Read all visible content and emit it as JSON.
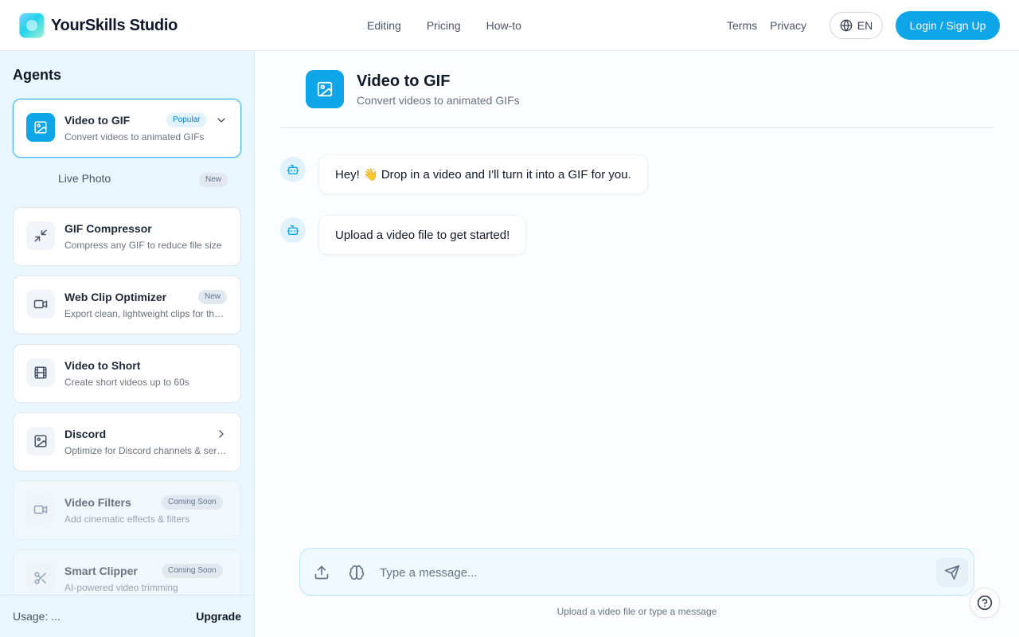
{
  "header": {
    "brand": "YourSkills Studio",
    "nav": [
      "Editing",
      "Pricing",
      "How-to"
    ],
    "terms": "Terms",
    "privacy": "Privacy",
    "language": "EN",
    "login": "Login / Sign Up"
  },
  "sidebar": {
    "title": "Agents",
    "agents": [
      {
        "title": "Video to GIF",
        "desc": "Convert videos to animated GIFs",
        "badge": "Popular",
        "icon": "image-icon",
        "state": "active"
      },
      {
        "title": "GIF Compressor",
        "desc": "Compress any GIF to reduce file size",
        "badge": "",
        "icon": "compress-arrows-icon",
        "state": "normal"
      },
      {
        "title": "Web Clip Optimizer",
        "desc": "Export clean, lightweight clips for the web",
        "badge": "New",
        "icon": "video-camera-icon",
        "state": "normal"
      },
      {
        "title": "Video to Short",
        "desc": "Create short videos up to 60s",
        "badge": "",
        "icon": "film-icon",
        "state": "normal"
      },
      {
        "title": "Discord",
        "desc": "Optimize for Discord channels & servers",
        "badge": "",
        "icon": "image-icon",
        "state": "normal"
      },
      {
        "title": "Video Filters",
        "desc": "Add cinematic effects & filters",
        "badge": "Coming Soon",
        "icon": "video-camera-icon",
        "state": "disabled"
      },
      {
        "title": "Smart Clipper",
        "desc": "AI-powered video trimming",
        "badge": "Coming Soon",
        "icon": "scissors-icon",
        "state": "disabled"
      }
    ],
    "sub_item": {
      "label": "Live Photo",
      "badge": "New"
    },
    "usage": "Usage: ...",
    "upgrade": "Upgrade"
  },
  "main": {
    "agent_title": "Video to GIF",
    "agent_subtitle": "Convert videos to animated GIFs",
    "messages": [
      "Hey! 👋 Drop in a video and I'll turn it into a GIF for you.",
      "Upload a video file to get started!"
    ],
    "composer": {
      "placeholder": "Type a message...",
      "hint": "Upload a video file or type a message"
    }
  },
  "colors": {
    "accent": "#0ea5e9",
    "sidebar_bg": "#eaf6fd",
    "badge_bg": "#e0f2fe"
  }
}
